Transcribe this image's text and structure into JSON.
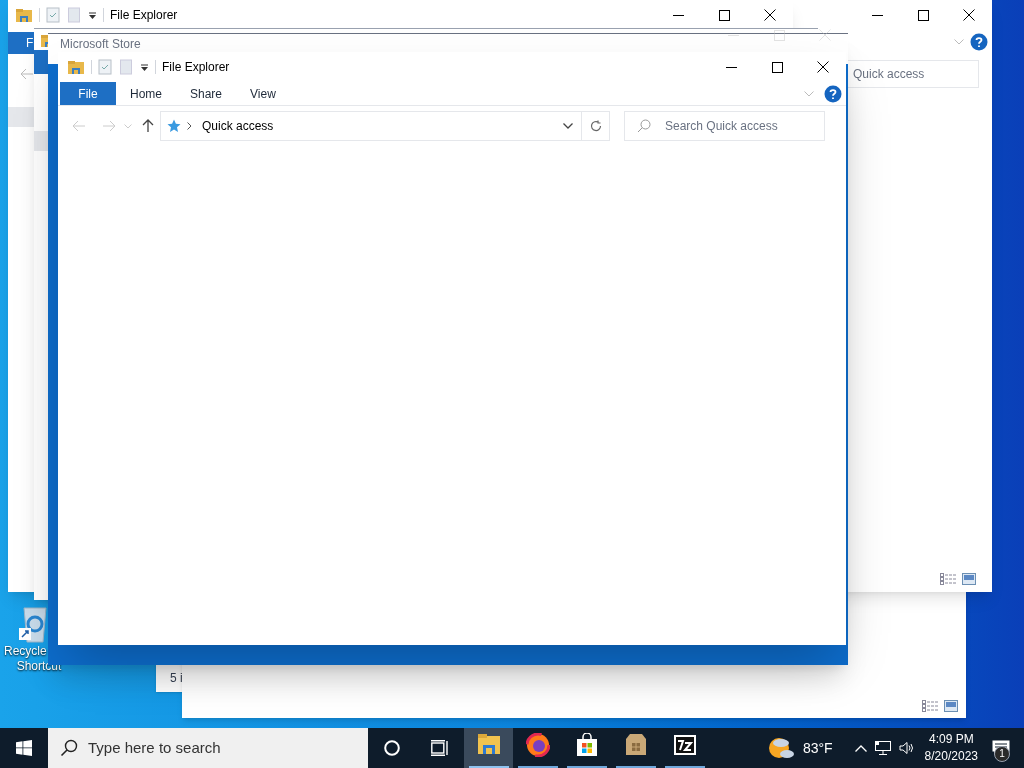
{
  "desktop_icons": [
    {
      "label_lines": [
        "Recycle",
        "Shortcut"
      ]
    }
  ],
  "back_windows": [
    {
      "status_text": "5 i"
    }
  ],
  "right_window": {
    "search_placeholder": "Quick access"
  },
  "left_window": {
    "title": "File Explorer",
    "tab_label": "F"
  },
  "store_window": {
    "title": "Microsoft Store"
  },
  "main_window": {
    "title": "File Explorer",
    "ribbon_tabs": [
      {
        "label": "File",
        "selected": true
      },
      {
        "label": "Home",
        "selected": false
      },
      {
        "label": "Share",
        "selected": false
      },
      {
        "label": "View",
        "selected": false
      }
    ],
    "address": "Quick access",
    "search_placeholder": "Search Quick access"
  },
  "taskbar": {
    "search_placeholder": "Type here to search",
    "apps": [
      {
        "kind": "explorer",
        "active": true
      },
      {
        "kind": "firefox",
        "active": false
      },
      {
        "kind": "store",
        "active": false
      },
      {
        "kind": "package",
        "active": false
      },
      {
        "kind": "sevenzip",
        "active": false
      }
    ],
    "weather": "83°F",
    "time": "4:09 PM",
    "date": "8/20/2023",
    "notification_count": "1"
  }
}
